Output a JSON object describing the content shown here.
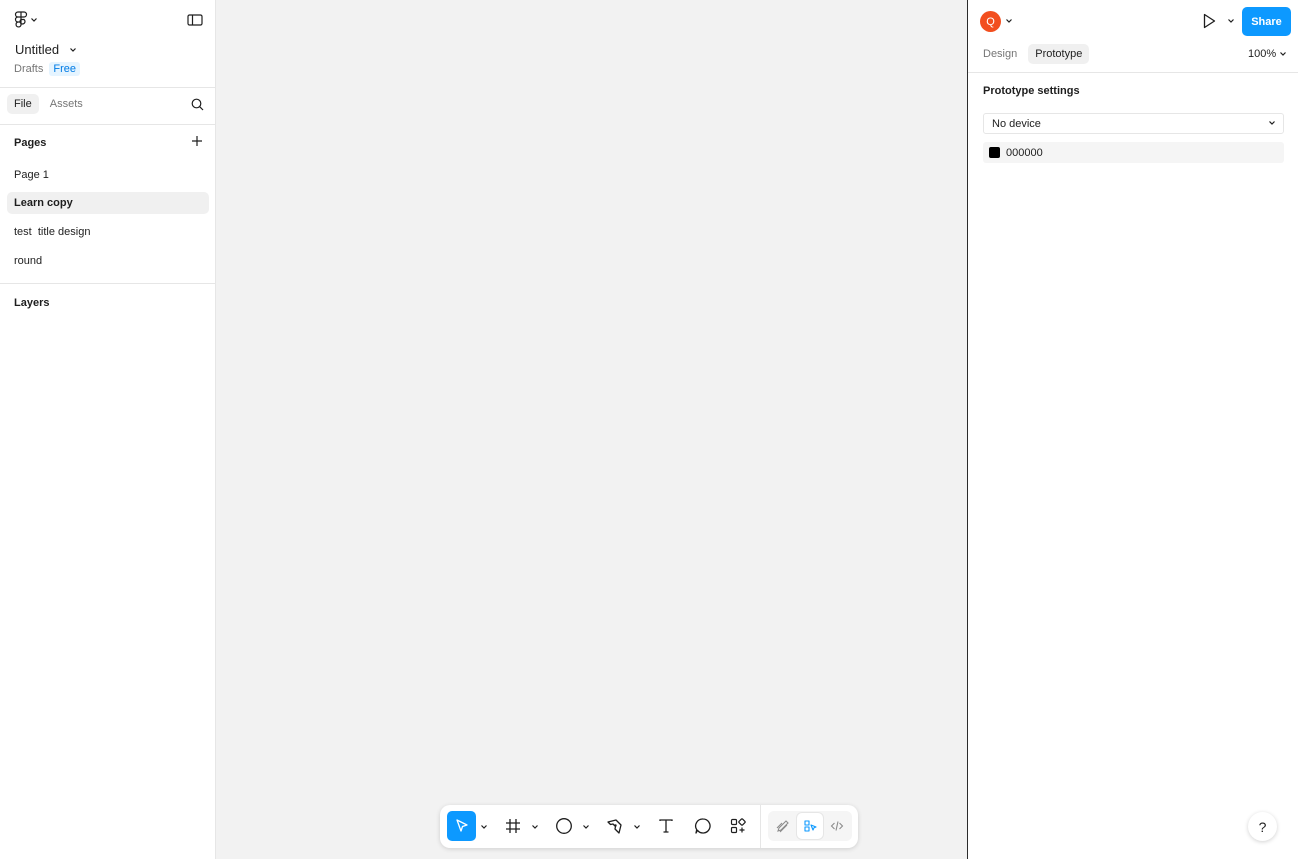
{
  "file": {
    "title": "Untitled",
    "location": "Drafts",
    "plan_badge": "Free"
  },
  "left_tabs": {
    "file": "File",
    "assets": "Assets"
  },
  "pages": {
    "heading": "Pages",
    "items": [
      {
        "label": "Page 1"
      },
      {
        "label": "Learn copy",
        "selected": true
      },
      {
        "label": "test  title design"
      },
      {
        "label": "round"
      }
    ]
  },
  "layers": {
    "heading": "Layers"
  },
  "right": {
    "avatar_letter": "Q",
    "share_label": "Share",
    "tabs": {
      "design": "Design",
      "prototype": "Prototype"
    },
    "zoom": "100%",
    "prototype_settings_title": "Prototype settings",
    "device_value": "No device",
    "background_color": "000000",
    "help_label": "?"
  },
  "colors": {
    "accent": "#0d99ff",
    "avatar": "#f24e1e",
    "canvas": "#f2f2f2"
  }
}
